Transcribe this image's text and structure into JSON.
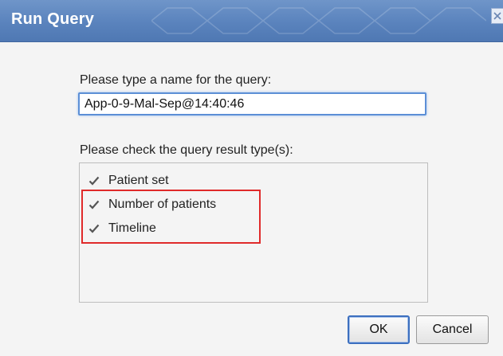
{
  "dialog": {
    "title": "Run Query",
    "name_label": "Please type a name for the query:",
    "name_value": "App-0-9-Mal-Sep@14:40:46",
    "result_label": "Please check the query result type(s):",
    "result_types": [
      {
        "label": "Patient set",
        "checked": true
      },
      {
        "label": "Number of patients",
        "checked": true
      },
      {
        "label": "Timeline",
        "checked": true
      }
    ],
    "ok_label": "OK",
    "cancel_label": "Cancel"
  },
  "colors": {
    "titlebar": "#5a83bd",
    "input_focus_border": "#5c8fd6",
    "highlight_box": "#e02a2a",
    "default_button_border": "#3c6fbf"
  },
  "icons": {
    "close": "close-icon",
    "checkbox": "checkmark-icon"
  }
}
